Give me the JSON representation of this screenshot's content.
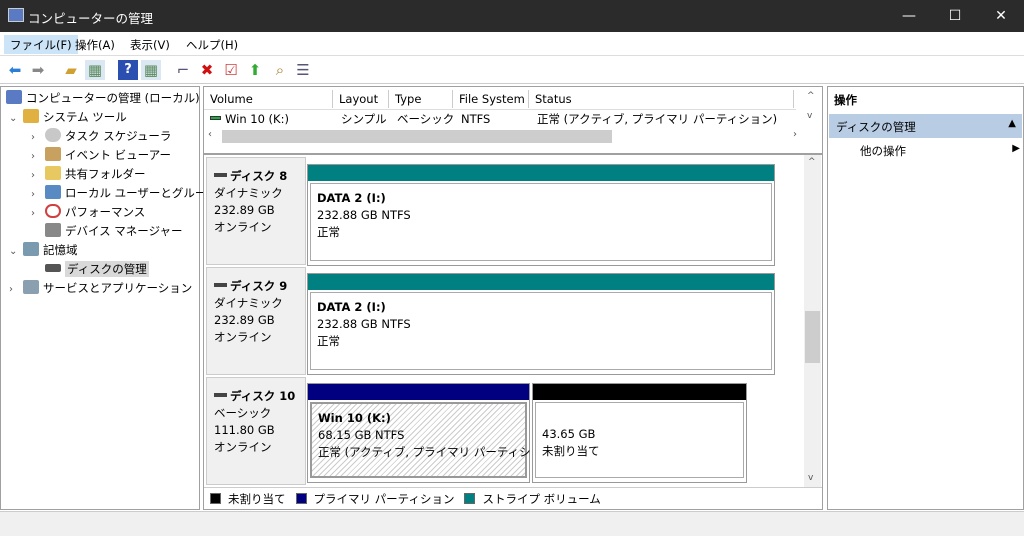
{
  "window": {
    "title": "コンピューターの管理",
    "minimize": "—",
    "maximize": "☐",
    "close": "✕"
  },
  "menu": [
    "ファイル(F)",
    "操作(A)",
    "表示(V)",
    "ヘルプ(H)"
  ],
  "toolbar": [
    "back-icon",
    "forward-icon",
    "up-folder-icon",
    "show-hide-tree-icon",
    "help-icon",
    "show-hide-action-pane-icon",
    "connect-drive-icon",
    "delete-icon",
    "properties-icon",
    "import-icon",
    "search-icon",
    "list-icon"
  ],
  "tree": [
    {
      "label": "コンピューターの管理 (ローカル)",
      "expander": "",
      "color": "#5a7bc4"
    },
    {
      "label": "システム ツール",
      "expander": "⌄",
      "color": "#e0b040"
    },
    {
      "label": "タスク スケジューラ",
      "expander": "›",
      "color": "#c8c8c8"
    },
    {
      "label": "イベント ビューアー",
      "expander": "›",
      "color": "#c8a060"
    },
    {
      "label": "共有フォルダー",
      "expander": "›",
      "color": "#e8c860"
    },
    {
      "label": "ローカル ユーザーとグループ",
      "expander": "›",
      "color": "#5a8ac4"
    },
    {
      "label": "パフォーマンス",
      "expander": "›",
      "color": "#d04040"
    },
    {
      "label": "デバイス マネージャー",
      "expander": "",
      "color": "#888"
    },
    {
      "label": "記憶域",
      "expander": "⌄",
      "color": "#7a9ab0"
    },
    {
      "label": "ディスクの管理",
      "expander": "",
      "color": "#555"
    },
    {
      "label": "サービスとアプリケーション",
      "expander": "›",
      "color": "#8aa0b0"
    }
  ],
  "volume_list": {
    "columns": [
      "Volume",
      "Layout",
      "Type",
      "File System",
      "Status"
    ],
    "rows": [
      {
        "volume": "Win 10 (K:)",
        "layout": "シンプル",
        "type": "ベーシック",
        "fs": "NTFS",
        "status": "正常 (アクティブ, プライマリ パーティション)"
      }
    ]
  },
  "disks": [
    {
      "name": "ディスク 8",
      "kind": "ダイナミック",
      "size": "232.89 GB",
      "state": "オンライン",
      "partitions": [
        {
          "title": "DATA 2  (I:)",
          "size": "232.88 GB NTFS",
          "status": "正常",
          "color": "#008080"
        }
      ]
    },
    {
      "name": "ディスク 9",
      "kind": "ダイナミック",
      "size": "232.89 GB",
      "state": "オンライン",
      "partitions": [
        {
          "title": "DATA 2  (I:)",
          "size": "232.88 GB NTFS",
          "status": "正常",
          "color": "#008080"
        }
      ]
    },
    {
      "name": "ディスク 10",
      "kind": "ベーシック",
      "size": "111.80 GB",
      "state": "オンライン",
      "partitions": [
        {
          "title": "Win 10  (K:)",
          "size": "68.15 GB NTFS",
          "status": "正常 (アクティブ, プライマリ パーティション)",
          "color": "#000080"
        },
        {
          "title": "",
          "size": "43.65 GB",
          "status": "未割り当て",
          "color": "#000000"
        }
      ]
    }
  ],
  "legend": [
    {
      "label": "未割り当て",
      "color": "#000000"
    },
    {
      "label": "プライマリ パーティション",
      "color": "#000080"
    },
    {
      "label": "ストライプ ボリューム",
      "color": "#008080"
    }
  ],
  "actions": {
    "header": "操作",
    "section": "ディスクの管理",
    "item": "他の操作"
  }
}
